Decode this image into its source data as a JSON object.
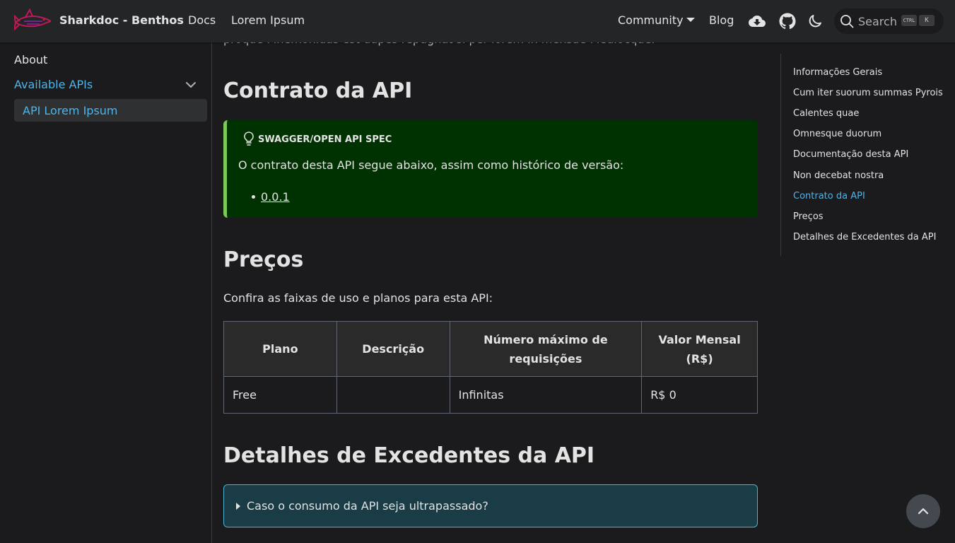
{
  "navbar": {
    "brand_title": "Sharkdoc - Benthos",
    "links": {
      "docs": "Docs",
      "lorem": "Lorem Ipsum",
      "community": "Community",
      "blog": "Blog"
    },
    "icons": [
      "cloud-download-icon",
      "github-icon",
      "moon-icon"
    ],
    "search": {
      "label": "Search",
      "kbd_ctrl": "CTRL",
      "kbd_k": "K"
    }
  },
  "sidebar": {
    "items": [
      {
        "label": "About"
      },
      {
        "label": "Available APIs"
      },
      {
        "label": "API Lorem Ipsum"
      }
    ]
  },
  "main": {
    "clipped_text": "proque Mnemonidas est dupes repugnat si per lorem in mensae Mediocque.",
    "contrato_heading": "Contrato da API",
    "admonition": {
      "title": "SWAGGER/OPEN API SPEC",
      "text": "O contrato desta API segue abaixo, assim como histórico de versão:",
      "link": "0.0.1"
    },
    "precos_heading": "Preços",
    "precos_text": "Confira as faixas de uso e planos para esta API:",
    "table": {
      "headers": [
        "Plano",
        "Descrição",
        "Número máximo de requisições",
        "Valor Mensal (R$)"
      ],
      "rows": [
        [
          "Free",
          "",
          "Infinitas",
          "R$ 0"
        ]
      ]
    },
    "detalhes_heading": "Detalhes de Excedentes da API",
    "details_summary": "Caso o consumo da API seja ultrapassado?"
  },
  "toc": {
    "items": [
      "Informações Gerais",
      "Cum iter suorum summas Pyrois",
      "Calentes quae",
      "Omnesque duorum",
      "Documentação desta API",
      "Non decebat nostra",
      "Contrato da API",
      "Preços",
      "Detalhes de Excedentes da API"
    ],
    "active_index": 6
  },
  "colors": {
    "accent": "#4fb4e9",
    "tip_bg": "#003100",
    "tip_border": "#7bca57",
    "info_bg": "#193c47"
  }
}
